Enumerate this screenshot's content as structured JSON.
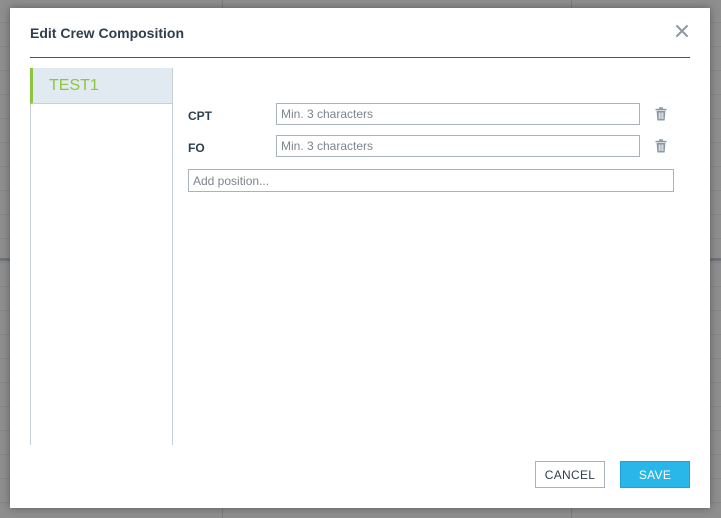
{
  "dialog": {
    "title": "Edit Crew Composition",
    "close_icon": "close-icon"
  },
  "sidebar": {
    "items": [
      {
        "label": "TEST1",
        "selected": true
      }
    ]
  },
  "positions": [
    {
      "label": "CPT",
      "placeholder": "Min. 3 characters",
      "value": ""
    },
    {
      "label": "FO",
      "placeholder": "Min. 3 characters",
      "value": ""
    }
  ],
  "add_position": {
    "placeholder": "Add position..."
  },
  "footer": {
    "cancel_label": "CANCEL",
    "save_label": "SAVE"
  },
  "colors": {
    "accent_green": "#8cc63f",
    "save_blue": "#29b6e8",
    "selected_bg": "#e1e9f1",
    "title_text": "#2f3e4d"
  }
}
